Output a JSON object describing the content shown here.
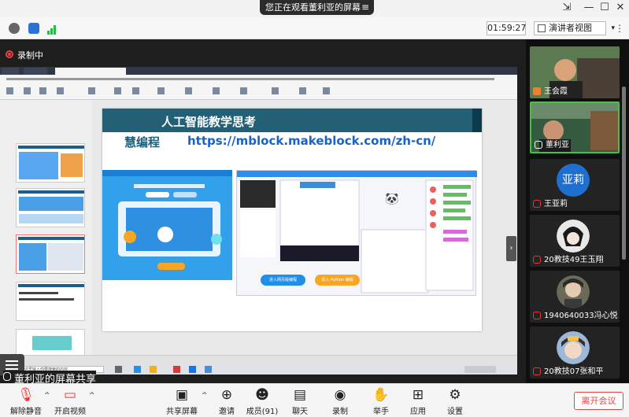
{
  "window": {
    "share_notice": "您正在观看董利亚的屏幕",
    "share_menu_icon": "≡"
  },
  "toolbar": {
    "timer": "01:59:27",
    "presenter_view": "演讲者视图"
  },
  "recording": {
    "label": "录制中"
  },
  "shared_screen": {
    "slide_title": "人工智能教学思考",
    "slide_subtitle": "慧编程",
    "slide_url": "https://mblock.makeblock.com/zh-cn/",
    "btn_blue": "进入网页版编程",
    "btn_orange": "进入 Python 编程",
    "taskbar_search": "在这里输入你要搜索的内容",
    "sharer_label": "董利亚的屏幕共享"
  },
  "participants": [
    {
      "name": "王会霞",
      "type": "video",
      "muted": false,
      "bg": "#3b4a3a"
    },
    {
      "name": "董利亚",
      "type": "video",
      "muted": false,
      "active": true,
      "bg": "#2b4a33"
    },
    {
      "name": "王亚莉",
      "type": "avatar",
      "avatar_text": "亚莉",
      "muted": true,
      "avatar_color": "#1f6fd1"
    },
    {
      "name": "20教技49王玉翔",
      "type": "photo",
      "muted": true,
      "bg": "#d8d8d8"
    },
    {
      "name": "1940640033冯心悦",
      "type": "photo",
      "muted": true,
      "bg": "#6a6a58"
    },
    {
      "name": "20教技07张和平",
      "type": "photo",
      "muted": true,
      "bg": "#9bb8d8"
    }
  ],
  "bottom_bar": {
    "unmute": "解除静音",
    "start_video": "开启视频",
    "share_screen": "共享屏幕",
    "invite": "邀请",
    "members": "成员(91)",
    "chat": "聊天",
    "record": "录制",
    "raise_hand": "举手",
    "apps": "应用",
    "settings": "设置",
    "leave": "离开会议"
  },
  "colors": {
    "accent_green": "#3ec63e",
    "leave_red": "#e54545",
    "record_red": "#e94242"
  }
}
